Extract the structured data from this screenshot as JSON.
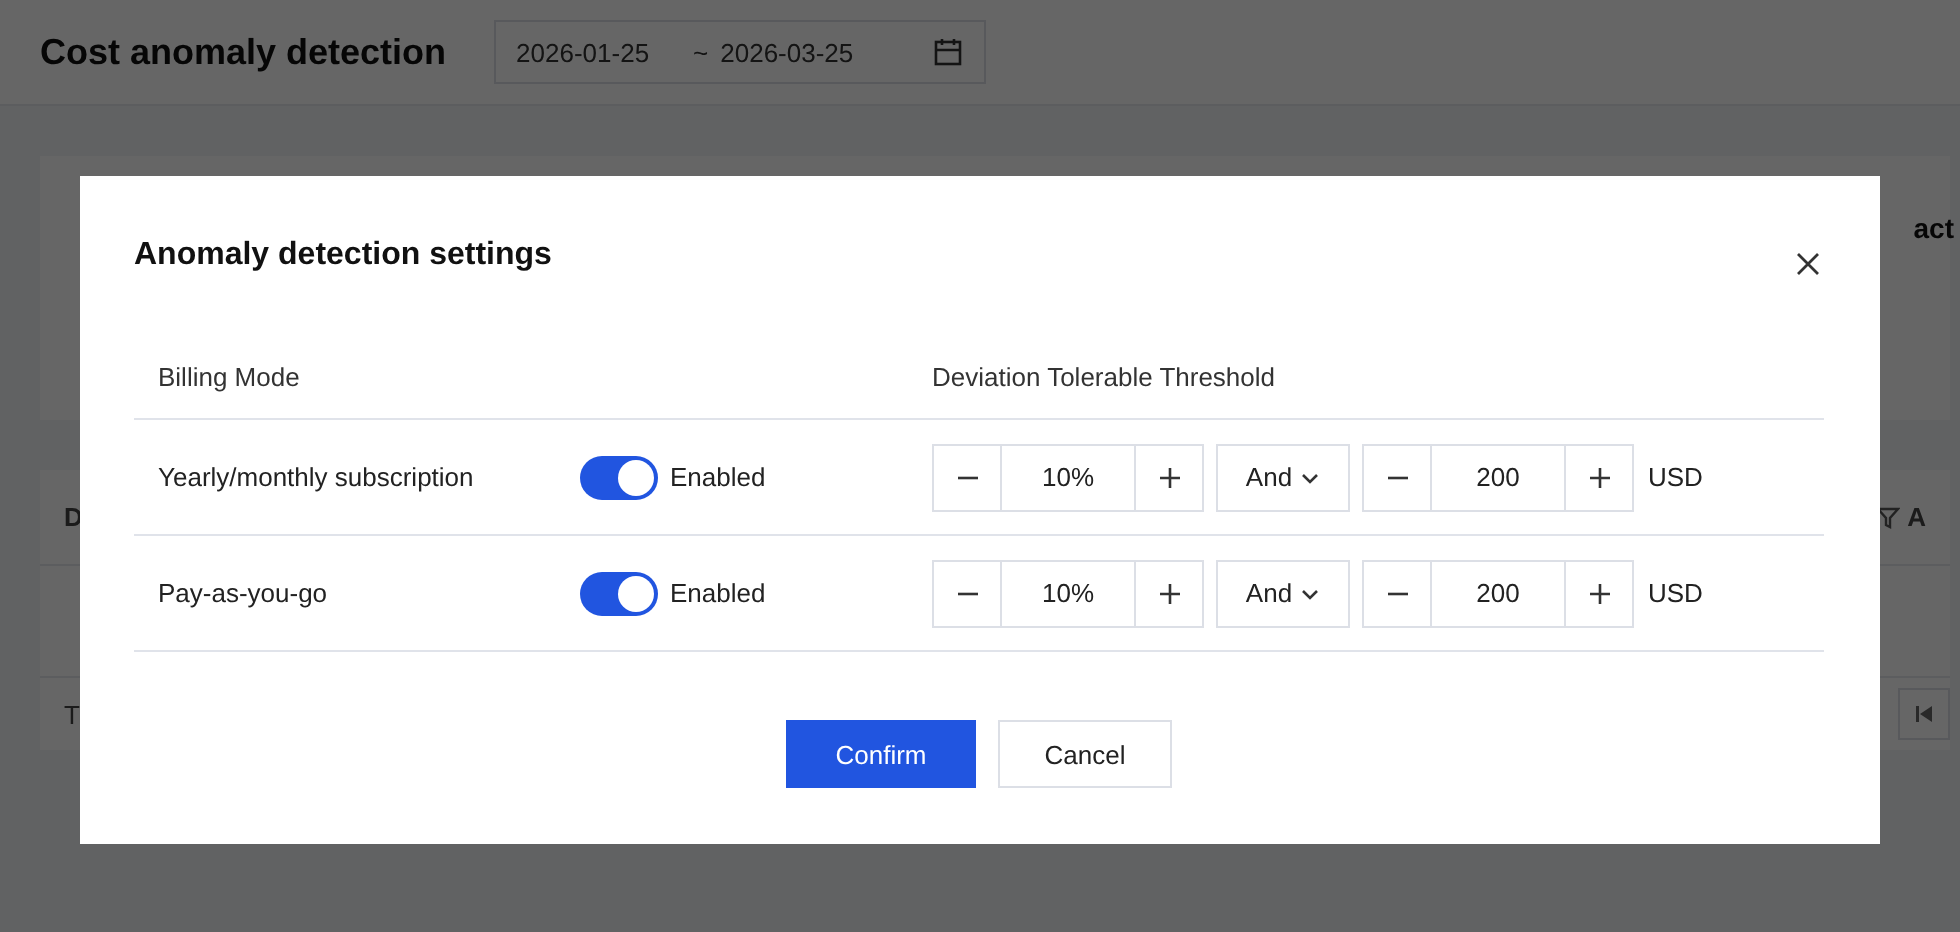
{
  "page": {
    "title": "Cost anomaly detection",
    "date_range": {
      "start": "2026-01-25",
      "separator": "~",
      "end": "2026-03-25"
    }
  },
  "background": {
    "card_title_fragment": "act",
    "table_header_fragments": [
      "D",
      "A"
    ],
    "footer_fragment": "T"
  },
  "dialog": {
    "title": "Anomaly detection settings",
    "columns": [
      "Billing Mode",
      "Deviation Tolerable Threshold"
    ],
    "rows": [
      {
        "billing_mode": "Yearly/monthly subscription",
        "enabled": true,
        "status": "Enabled",
        "percent": "10%",
        "operator": "And",
        "amount": "200",
        "currency": "USD"
      },
      {
        "billing_mode": "Pay-as-you-go",
        "enabled": true,
        "status": "Enabled",
        "percent": "10%",
        "operator": "And",
        "amount": "200",
        "currency": "USD"
      }
    ],
    "buttons": [
      {
        "label": "Confirm",
        "kind": "primary"
      },
      {
        "label": "Cancel",
        "kind": "secondary"
      }
    ]
  }
}
